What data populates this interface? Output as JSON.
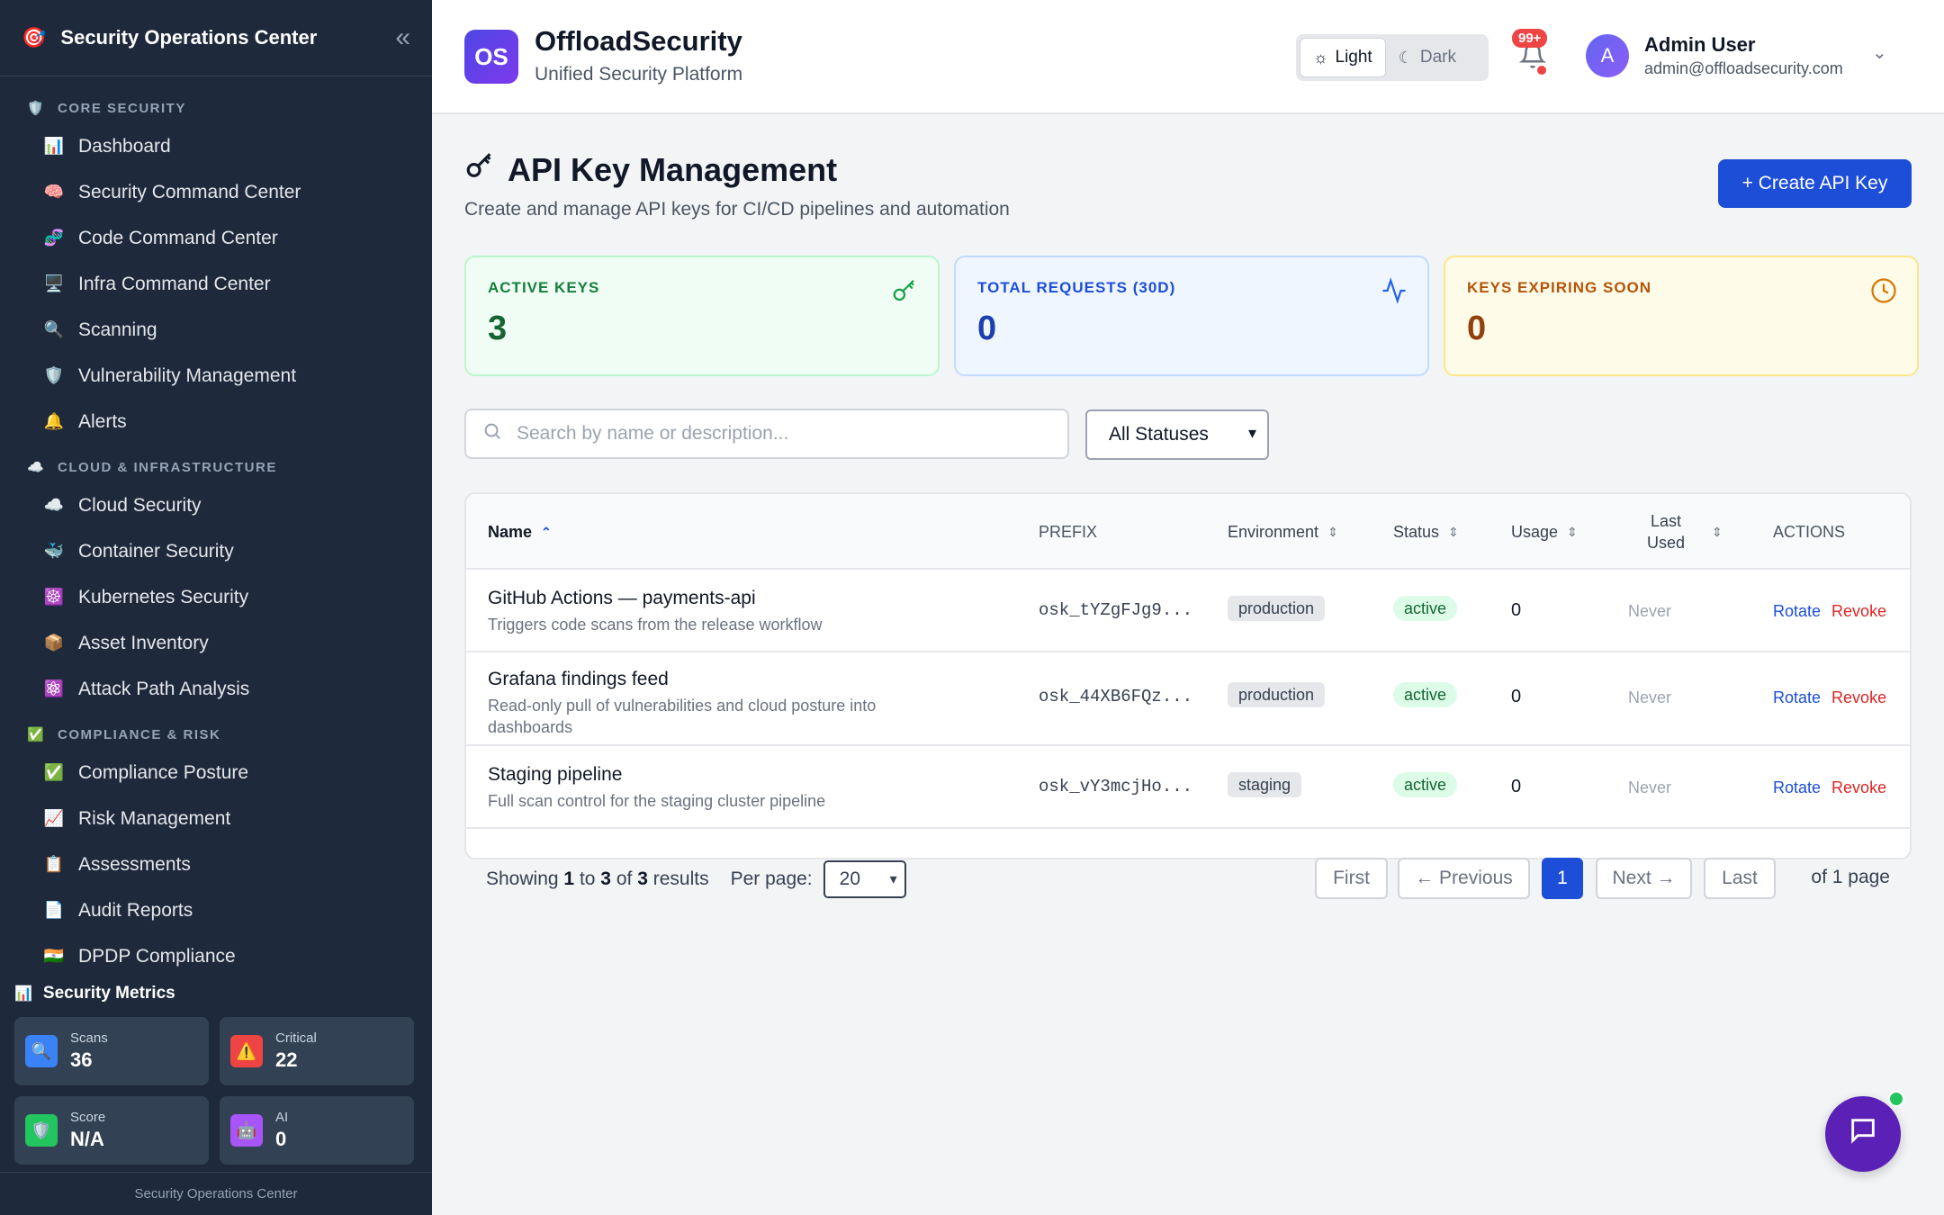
{
  "sidebar": {
    "title": "Security Operations Center",
    "sections": [
      {
        "label": "CORE SECURITY",
        "icon": "🛡️",
        "items": [
          {
            "label": "Dashboard",
            "icon": "📊"
          },
          {
            "label": "Security Command Center",
            "icon": "🧠"
          },
          {
            "label": "Code Command Center",
            "icon": "🧬"
          },
          {
            "label": "Infra Command Center",
            "icon": "🖥️"
          },
          {
            "label": "Scanning",
            "icon": "🔍"
          },
          {
            "label": "Vulnerability Management",
            "icon": "🛡️"
          },
          {
            "label": "Alerts",
            "icon": "🔔"
          }
        ]
      },
      {
        "label": "CLOUD & INFRASTRUCTURE",
        "icon": "☁️",
        "items": [
          {
            "label": "Cloud Security",
            "icon": "☁️"
          },
          {
            "label": "Container Security",
            "icon": "🐳"
          },
          {
            "label": "Kubernetes Security",
            "icon": "☸️"
          },
          {
            "label": "Asset Inventory",
            "icon": "📦"
          },
          {
            "label": "Attack Path Analysis",
            "icon": "⚛️"
          }
        ]
      },
      {
        "label": "COMPLIANCE & RISK",
        "icon": "✅",
        "items": [
          {
            "label": "Compliance Posture",
            "icon": "✅"
          },
          {
            "label": "Risk Management",
            "icon": "📈"
          },
          {
            "label": "Assessments",
            "icon": "📋"
          },
          {
            "label": "Audit Reports",
            "icon": "📄"
          },
          {
            "label": "DPDP Compliance",
            "icon": "🇮🇳"
          }
        ]
      }
    ],
    "metrics_title": "Security Metrics",
    "metrics": [
      {
        "label": "Scans",
        "value": "36",
        "icon": "🔍",
        "color": "#3b82f6"
      },
      {
        "label": "Critical",
        "value": "22",
        "icon": "⚠️",
        "color": "#ef4444"
      },
      {
        "label": "Score",
        "value": "N/A",
        "icon": "🛡️",
        "color": "#22c55e"
      },
      {
        "label": "AI",
        "value": "0",
        "icon": "🤖",
        "color": "#a855f7"
      }
    ],
    "footer": "Security Operations Center"
  },
  "header": {
    "logo_text": "OS",
    "brand": "OffloadSecurity",
    "subtitle": "Unified Security Platform",
    "theme_light": "Light",
    "theme_dark": "Dark",
    "notifications": "99+",
    "avatar_letter": "A",
    "user_name": "Admin User",
    "user_email": "admin@offloadsecurity.com"
  },
  "page": {
    "title": "API Key Management",
    "subtitle": "Create and manage API keys for CI/CD pipelines and automation",
    "create_button": "+ Create API Key"
  },
  "stats": [
    {
      "label": "ACTIVE KEYS",
      "value": "3",
      "icon": "key-icon"
    },
    {
      "label": "TOTAL REQUESTS (30D)",
      "value": "0",
      "icon": "activity-icon"
    },
    {
      "label": "KEYS EXPIRING SOON",
      "value": "0",
      "icon": "clock-icon"
    }
  ],
  "search": {
    "placeholder": "Search by name or description..."
  },
  "status_filter": {
    "selected": "All Statuses"
  },
  "table": {
    "columns": {
      "name": "Name",
      "prefix": "PREFIX",
      "environment": "Environment",
      "status": "Status",
      "usage": "Usage",
      "last_used_1": "Last",
      "last_used_2": "Used",
      "actions": "ACTIONS"
    },
    "rows": [
      {
        "name": "GitHub Actions — payments-api",
        "description": "Triggers code scans from the release workflow",
        "prefix": "osk_tYZgFJg9...",
        "environment": "production",
        "status": "active",
        "usage": "0",
        "last_used": "Never",
        "rotate": "Rotate",
        "revoke": "Revoke"
      },
      {
        "name": "Grafana findings feed",
        "description": "Read-only pull of vulnerabilities and cloud posture into dashboards",
        "prefix": "osk_44XB6FQz...",
        "environment": "production",
        "status": "active",
        "usage": "0",
        "last_used": "Never",
        "rotate": "Rotate",
        "revoke": "Revoke"
      },
      {
        "name": "Staging pipeline",
        "description": "Full scan control for the staging cluster pipeline",
        "prefix": "osk_vY3mcjHo...",
        "environment": "staging",
        "status": "active",
        "usage": "0",
        "last_used": "Never",
        "rotate": "Rotate",
        "revoke": "Revoke"
      }
    ]
  },
  "pagination": {
    "showing_prefix": "Showing",
    "from": "1",
    "to_word": "to",
    "to": "3",
    "of_word": "of",
    "total": "3",
    "results_word": "results",
    "per_page_label": "Per page:",
    "per_page": "20",
    "first": "First",
    "previous": "← Previous",
    "current": "1",
    "next": "Next →",
    "last": "Last",
    "of_pages": "of 1 page"
  }
}
